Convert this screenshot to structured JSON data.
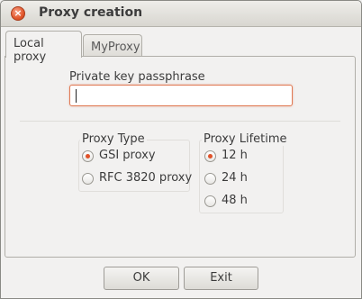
{
  "window": {
    "title": "Proxy creation",
    "close_glyph": "×"
  },
  "tabs": [
    {
      "label": "Local proxy",
      "active": true
    },
    {
      "label": "MyProxy",
      "active": false
    }
  ],
  "passphrase": {
    "label": "Private key passphrase",
    "value": ""
  },
  "proxy_type": {
    "title": "Proxy Type",
    "options": [
      {
        "label": "GSI proxy",
        "selected": true
      },
      {
        "label": "RFC 3820 proxy",
        "selected": false
      }
    ]
  },
  "proxy_lifetime": {
    "title": "Proxy Lifetime",
    "options": [
      {
        "label": "12 h",
        "selected": true
      },
      {
        "label": "24 h",
        "selected": false
      },
      {
        "label": "48 h",
        "selected": false
      }
    ]
  },
  "buttons": {
    "ok": "OK",
    "exit": "Exit"
  },
  "colors": {
    "accent": "#e0522a",
    "focus_border": "#e07a55"
  }
}
